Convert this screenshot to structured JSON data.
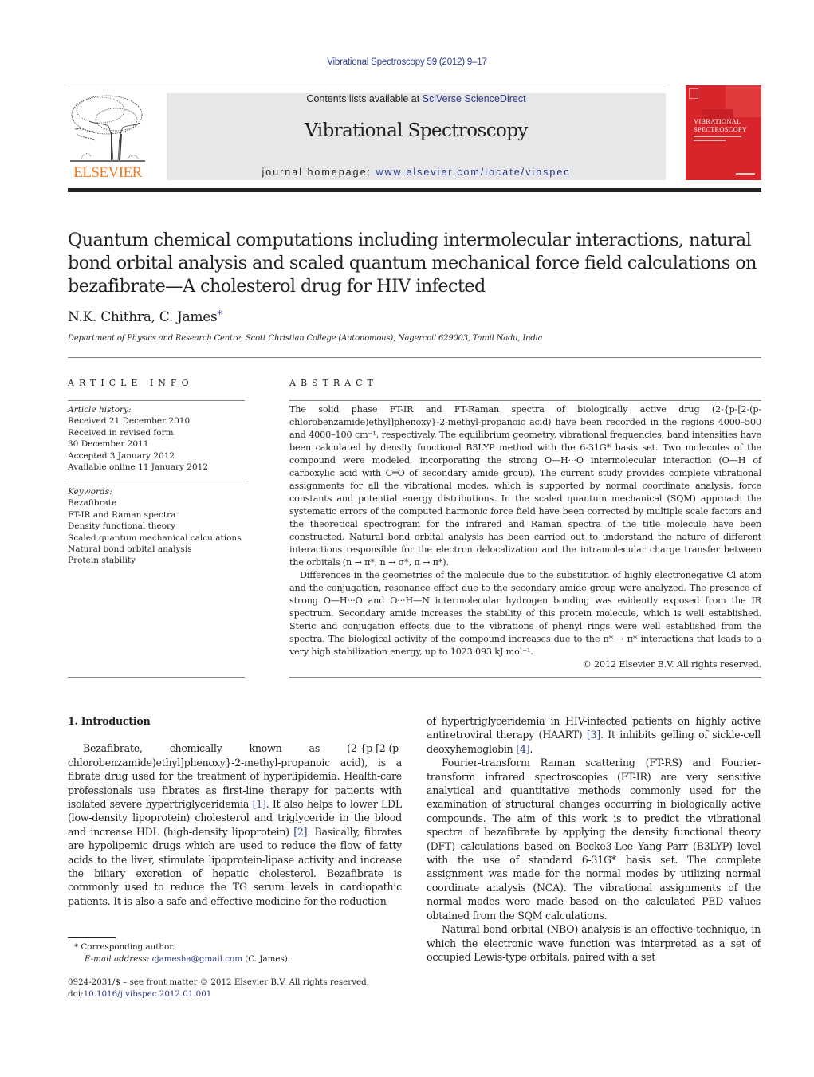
{
  "header": {
    "citation": "Vibrational Spectroscopy 59 (2012) 9–17",
    "contents_prefix": "Contents lists available at ",
    "contents_link": "SciVerse ScienceDirect",
    "journal_title": "Vibrational Spectroscopy",
    "homepage_prefix": "journal homepage: ",
    "homepage_link": "www.elsevier.com/locate/vibspec",
    "publisher_logo_text": "ELSEVIER",
    "cover_title_line1": "VIBRATIONAL",
    "cover_title_line2": "SPECTROSCOPY",
    "colors": {
      "link": "#2b3a87",
      "publisher_orange": "#f47b20",
      "cover_red": "#d7252b",
      "masthead_grey": "#e6e7e8"
    }
  },
  "article": {
    "title": "Quantum chemical computations including intermolecular interactions, natural bond orbital analysis and scaled quantum mechanical force field calculations on bezafibrate—A cholesterol drug for HIV infected",
    "authors": "N.K. Chithra, C. James",
    "corresponding_marker": "*",
    "affiliation": "Department of Physics and Research Centre, Scott Christian College (Autonomous), Nagercoil 629003, Tamil Nadu, India"
  },
  "article_info": {
    "label": "ARTICLE INFO",
    "history_label": "Article history:",
    "history": [
      "Received 21 December 2010",
      "Received in revised form",
      "30 December 2011",
      "Accepted 3 January 2012",
      "Available online 11 January 2012"
    ],
    "keywords_label": "Keywords:",
    "keywords": [
      "Bezafibrate",
      "FT-IR and Raman spectra",
      "Density functional theory",
      "Scaled quantum mechanical calculations",
      "Natural bond orbital analysis",
      "Protein stability"
    ]
  },
  "abstract": {
    "label": "ABSTRACT",
    "paragraphs": [
      "The solid phase FT-IR and FT-Raman spectra of biologically active drug (2-{p-[2-(p-chlorobenzamide)ethyl]phenoxy}-2-methyl-propanoic acid) have been recorded in the regions 4000–500 and 4000–100 cm⁻¹, respectively. The equilibrium geometry, vibrational frequencies, band intensities have been calculated by density functional B3LYP method with the 6-31G* basis set. Two molecules of the compound were modeled, incorporating the strong O—H···O intermolecular interaction (O—H of carboxylic acid with C═O of secondary amide group). The current study provides complete vibrational assignments for all the vibrational modes, which is supported by normal coordinate analysis, force constants and potential energy distributions. In the scaled quantum mechanical (SQM) approach the systematic errors of the computed harmonic force field have been corrected by multiple scale factors and the theoretical spectrogram for the infrared and Raman spectra of the title molecule have been constructed. Natural bond orbital analysis has been carried out to understand the nature of different interactions responsible for the electron delocalization and the intramolecular charge transfer between the orbitals (n → π*, n → σ*, π → π*).",
      "Differences in the geometries of the molecule due to the substitution of highly electronegative Cl atom and the conjugation, resonance effect due to the secondary amide group were analyzed. The presence of strong O—H···O and O···H—N intermolecular hydrogen bonding was evidently exposed from the IR spectrum. Secondary amide increases the stability of this protein molecule, which is well established. Steric and conjugation effects due to the vibrations of phenyl rings were well established from the spectra. The biological activity of the compound increases due to the π* → π* interactions that leads to a very high stabilization energy, up to 1023.093 kJ mol⁻¹."
    ],
    "copyright": "© 2012 Elsevier B.V. All rights reserved."
  },
  "body": {
    "section_heading": "1.  Introduction",
    "left": {
      "p1_a": "Bezafibrate, chemically known as (2-{p-[2-(p-chlorobenzamide)ethyl]phenoxy}-2-methyl-propanoic acid), is a fibrate drug used for the treatment of hyperlipidemia. Health-care professionals use fibrates as first-line therapy for patients with isolated severe hypertriglyceridemia ",
      "ref1": "[1]",
      "p1_b": ". It also helps to lower LDL (low-density lipoprotein) cholesterol and triglyceride in the blood and increase HDL (high-density lipoprotein) ",
      "ref2": "[2]",
      "p1_c": ". Basically, fibrates are hypolipemic drugs which are used to reduce the flow of fatty acids to the liver, stimulate lipoprotein-lipase activity and increase the biliary excretion of hepatic cholesterol. Bezafibrate is commonly used to reduce the TG serum levels in cardiopathic patients. It is also a safe and effective medicine for the reduction"
    },
    "right": {
      "p1_a": "of hypertriglyceridemia in HIV-infected patients on highly active antiretroviral therapy (HAART) ",
      "ref3": "[3]",
      "p1_b": ". It inhibits gelling of sickle-cell deoxyhemoglobin ",
      "ref4": "[4]",
      "p1_c": ".",
      "p2": "Fourier-transform Raman scattering (FT-RS) and Fourier-transform infrared spectroscopies (FT-IR) are very sensitive analytical and quantitative methods commonly used for the examination of structural changes occurring in biologically active compounds. The aim of this work is to predict the vibrational spectra of bezafibrate by applying the density functional theory (DFT) calculations based on Becke3-Lee–Yang–Parr (B3LYP) level with the use of standard 6-31G* basis set. The complete assignment was made for the normal modes by utilizing normal coordinate analysis (NCA). The vibrational assignments of the normal modes were made based on the calculated PED values obtained from the SQM calculations.",
      "p3": "Natural bond orbital (NBO) analysis is an effective technique, in which the electronic wave function was interpreted as a set of occupied Lewis-type orbitals, paired with a set"
    }
  },
  "footnotes": {
    "corresponding": "* Corresponding author.",
    "email_label": "E-mail address: ",
    "email": "cjamesha@gmail.com",
    "email_suffix": " (C. James).",
    "front_matter": "0924-2031/$ – see front matter © 2012 Elsevier B.V. All rights reserved.",
    "doi_prefix": "doi:",
    "doi": "10.1016/j.vibspec.2012.01.001"
  }
}
